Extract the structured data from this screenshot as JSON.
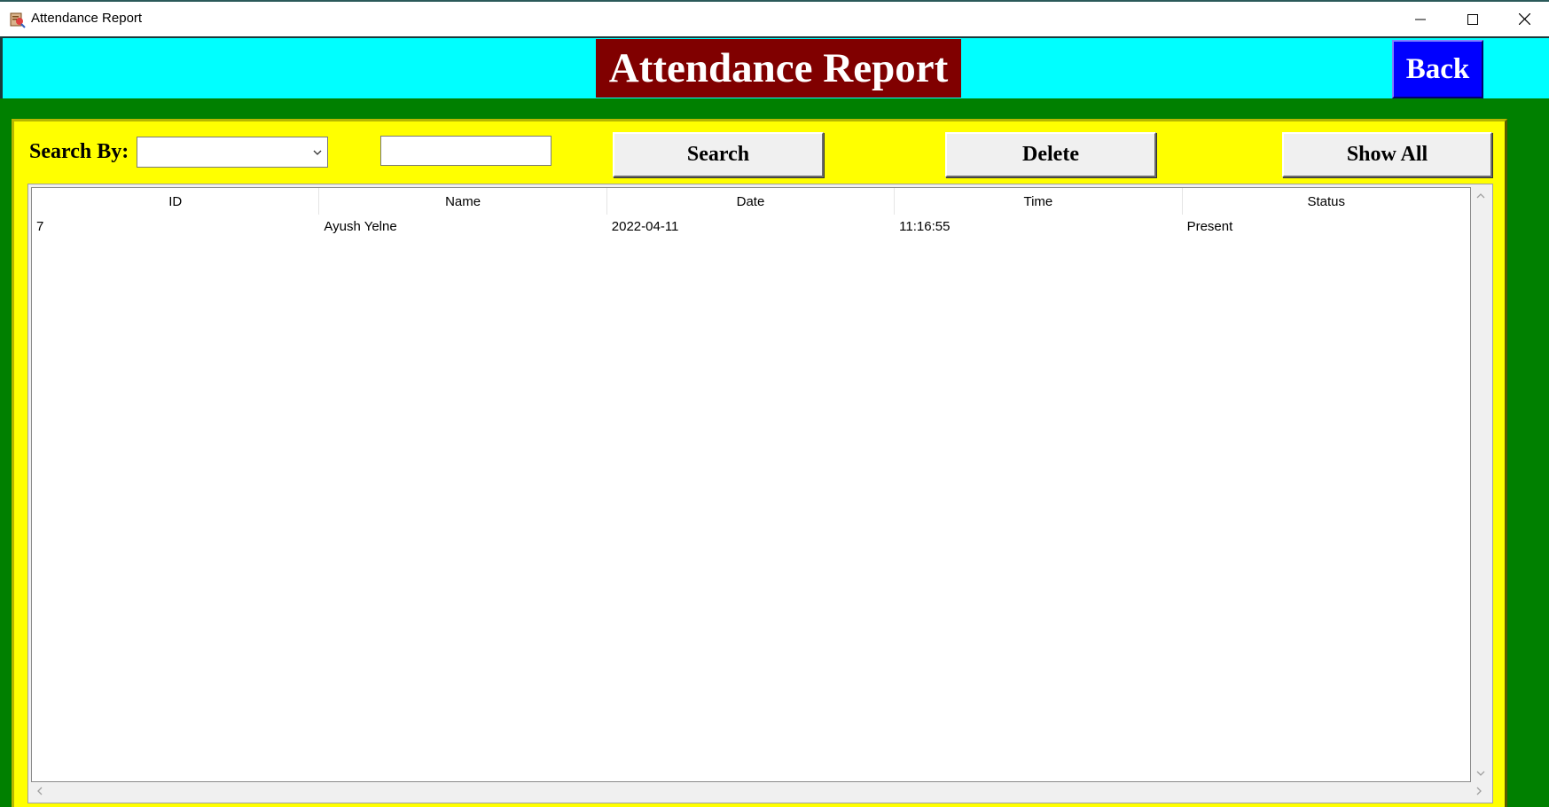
{
  "window": {
    "title": "Attendance Report",
    "controls": [
      "minimize",
      "maximize",
      "close"
    ]
  },
  "header": {
    "title": "Attendance Report",
    "back_label": "Back"
  },
  "search": {
    "label": "Search By:",
    "combo_value": "",
    "text_value": "",
    "search_label": "Search",
    "delete_label": "Delete",
    "show_all_label": "Show All"
  },
  "table": {
    "columns": [
      "ID",
      "Name",
      "Date",
      "Time",
      "Status"
    ],
    "rows": [
      [
        "7",
        "Ayush Yelne",
        "2022-04-11",
        "11:16:55",
        "Present"
      ]
    ]
  },
  "colors": {
    "header_bg": "#00ffff",
    "title_bg": "#800000",
    "back_bg": "#0000ff",
    "body_bg": "#008000",
    "panel_bg": "#ffff00"
  },
  "icons": {
    "app": "attendance-app-icon",
    "minimize": "minimize-icon",
    "maximize": "maximize-icon",
    "close": "close-icon",
    "dropdown": "chevron-down-icon"
  }
}
